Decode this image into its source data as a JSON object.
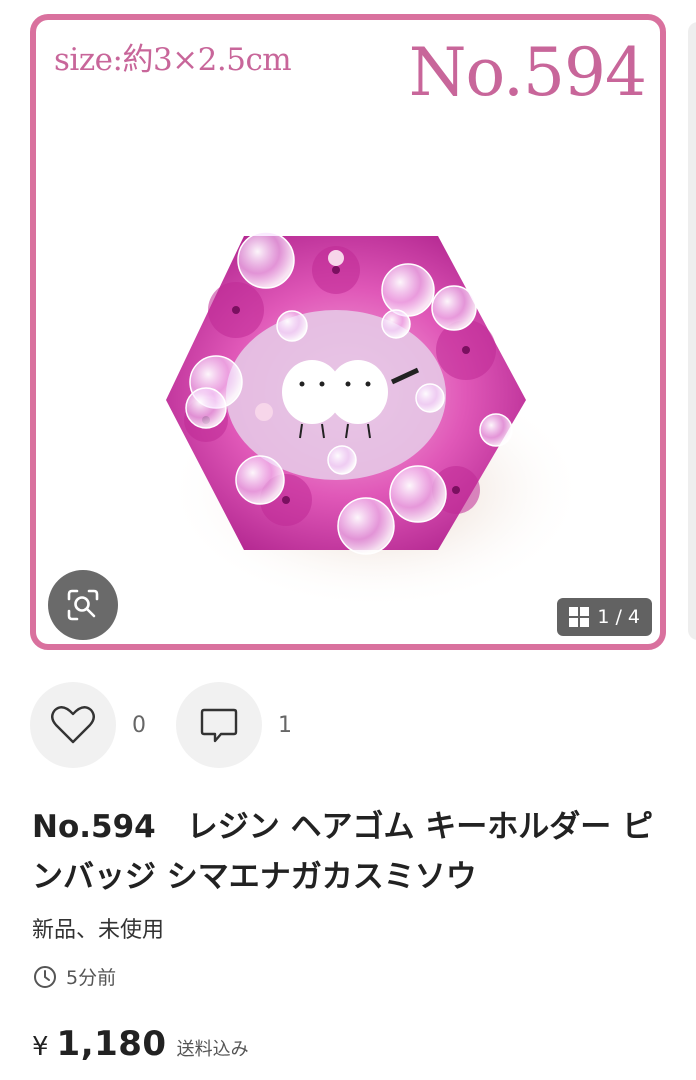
{
  "image": {
    "size_label": "size:約3×2.5cm",
    "item_number_label": "No.594",
    "counter": "1 / 4",
    "frame_color": "#d9719e",
    "label_color": "#c8669a"
  },
  "actions": {
    "like_count": "0",
    "comment_count": "1"
  },
  "item": {
    "title": "No.594　レジン ヘアゴム キーホルダー ピンバッジ シマエナガカスミソウ",
    "condition": "新品、未使用",
    "posted": "5分前",
    "currency": "¥",
    "price": "1,180",
    "shipping": "送料込み"
  }
}
